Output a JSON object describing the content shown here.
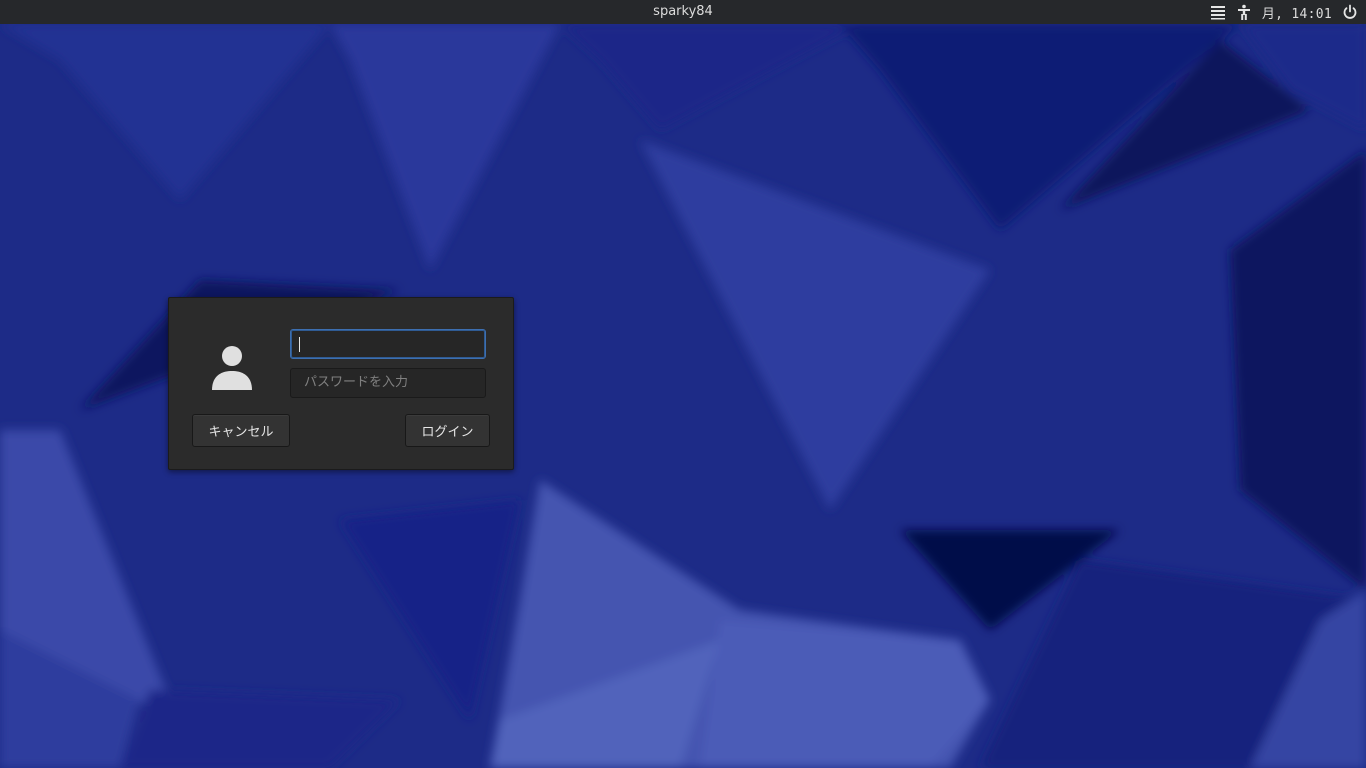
{
  "topbar": {
    "hostname": "sparky84",
    "clock": "月, 14:01",
    "icons": [
      "menu-icon",
      "accessibility-icon",
      "power-icon"
    ]
  },
  "login_dialog": {
    "username_value": "",
    "password_placeholder": "パスワードを入力",
    "cancel_label": "キャンセル",
    "login_label": "ログイン",
    "avatar_icon": "user-avatar-icon"
  },
  "colors": {
    "wallpaper_base": "#1e2a86",
    "panel": "#26282b",
    "dialog": "#2b2b2b",
    "focus": "#3d6fb0"
  }
}
